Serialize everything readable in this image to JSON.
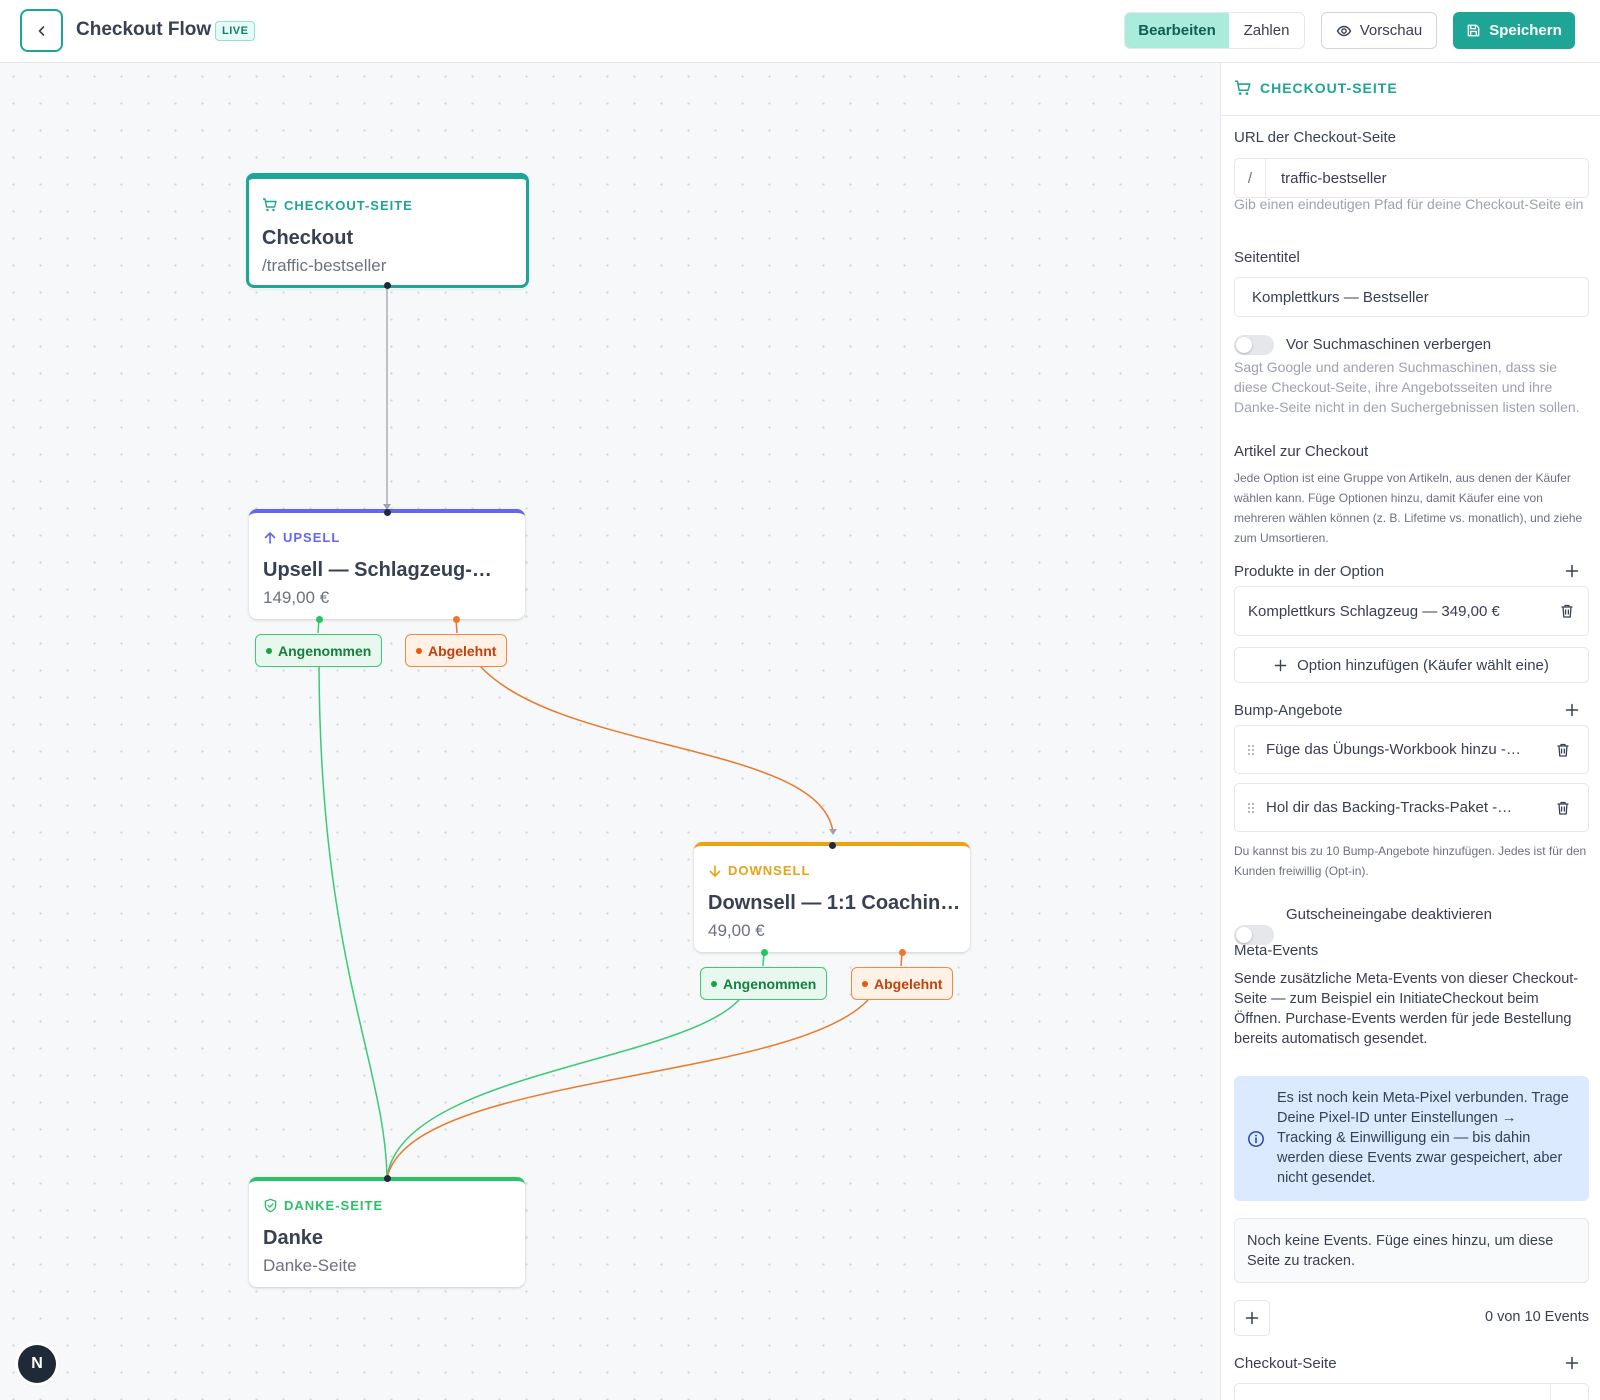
{
  "header": {
    "title": "Checkout Flow",
    "badge": "LIVE",
    "tabs": [
      {
        "label": "Bearbeiten",
        "active": true
      },
      {
        "label": "Zahlen",
        "active": false
      }
    ],
    "preview_label": "Vorschau",
    "save_label": "Speichern"
  },
  "colors": {
    "accent": "#1fa595",
    "upsell": "#6366f1",
    "downsell": "#e8a317",
    "thanks": "#2cc06b",
    "accepted": "#22c55e",
    "rejected": "#ea7a2a"
  },
  "canvas": {
    "nodes": {
      "checkout": {
        "type": "CHECKOUT-SEITE",
        "title": "Checkout",
        "subtitle": "/traffic-bestseller",
        "icon": "cart-icon"
      },
      "upsell": {
        "type": "UPSELL",
        "title": "Upsell — Schlagzeug-…",
        "subtitle": "149,00 €",
        "icon": "arrow-up-icon"
      },
      "downsell": {
        "type": "DOWNSELL",
        "title": "Downsell — 1:1 Coachin…",
        "subtitle": "49,00 €",
        "icon": "arrow-down-icon"
      },
      "thanks": {
        "type": "DANKE-SEITE",
        "title": "Danke",
        "subtitle": "Danke-Seite",
        "icon": "shield-check-icon"
      }
    },
    "branch_labels": {
      "accepted": "Angenommen",
      "rejected": "Abgelehnt"
    },
    "logo_letter": "N"
  },
  "panel": {
    "heading": "CHECKOUT-SEITE",
    "url_label": "URL der Checkout-Seite",
    "url_prefix": "/",
    "url_value": "traffic-bestseller",
    "url_hint": "Gib einen eindeutigen Pfad für deine Checkout-Seite ein",
    "page_title_label": "Seitentitel",
    "page_title_value": "Komplettkurs — Bestseller",
    "hide_search_label": "Vor Suchmaschinen verbergen",
    "hide_search_on": false,
    "hide_search_hint": "Sagt Google und anderen Suchmaschinen, dass sie diese Checkout-Seite, ihre Angebotsseiten und ihre Danke-Seite nicht in den Suchergebnissen listen sollen.",
    "items_label": "Artikel zur Checkout",
    "items_hint": "Jede Option ist eine Gruppe von Artikeln, aus denen der Käufer wählen kann. Füge Optionen hinzu, damit Käufer eine von mehreren wählen können (z. B. Lifetime vs. monatlich), und ziehe zum Umsortieren.",
    "products_label": "Produkte in der Option",
    "products": [
      "Komplettkurs Schlagzeug — 349,00 €"
    ],
    "add_option_label": "Option hinzufügen (Käufer wählt eine)",
    "bumps_label": "Bump-Angebote",
    "bumps": [
      "Füge das Übungs-Workbook hinzu -…",
      "Hol dir das Backing-Tracks-Paket -…"
    ],
    "bumps_hint": "Du kannst bis zu 10 Bump-Angebote hinzufügen. Jedes ist für den Kunden freiwillig (Opt-in).",
    "coupon_label": "Gutscheineingabe deaktivieren",
    "coupon_on": false,
    "meta_label": "Meta-Events",
    "meta_text": "Sende zusätzliche Meta-Events von dieser Checkout-Seite — zum Beispiel ein InitiateCheckout beim Öffnen. Purchase-Events werden für jede Bestellung bereits automatisch gesendet.",
    "meta_info": "Es ist noch kein Meta-Pixel verbunden. Trage Deine Pixel-ID unter Einstellungen → Tracking & Einwilligung ein — bis dahin werden diese Events zwar gespeichert, aber nicht gesendet.",
    "events_empty": "Noch keine Events. Füge eines hinzu, um diese Seite zu tracken.",
    "events_count": "0 von 10 Events",
    "checkout_page_label": "Checkout-Seite"
  }
}
